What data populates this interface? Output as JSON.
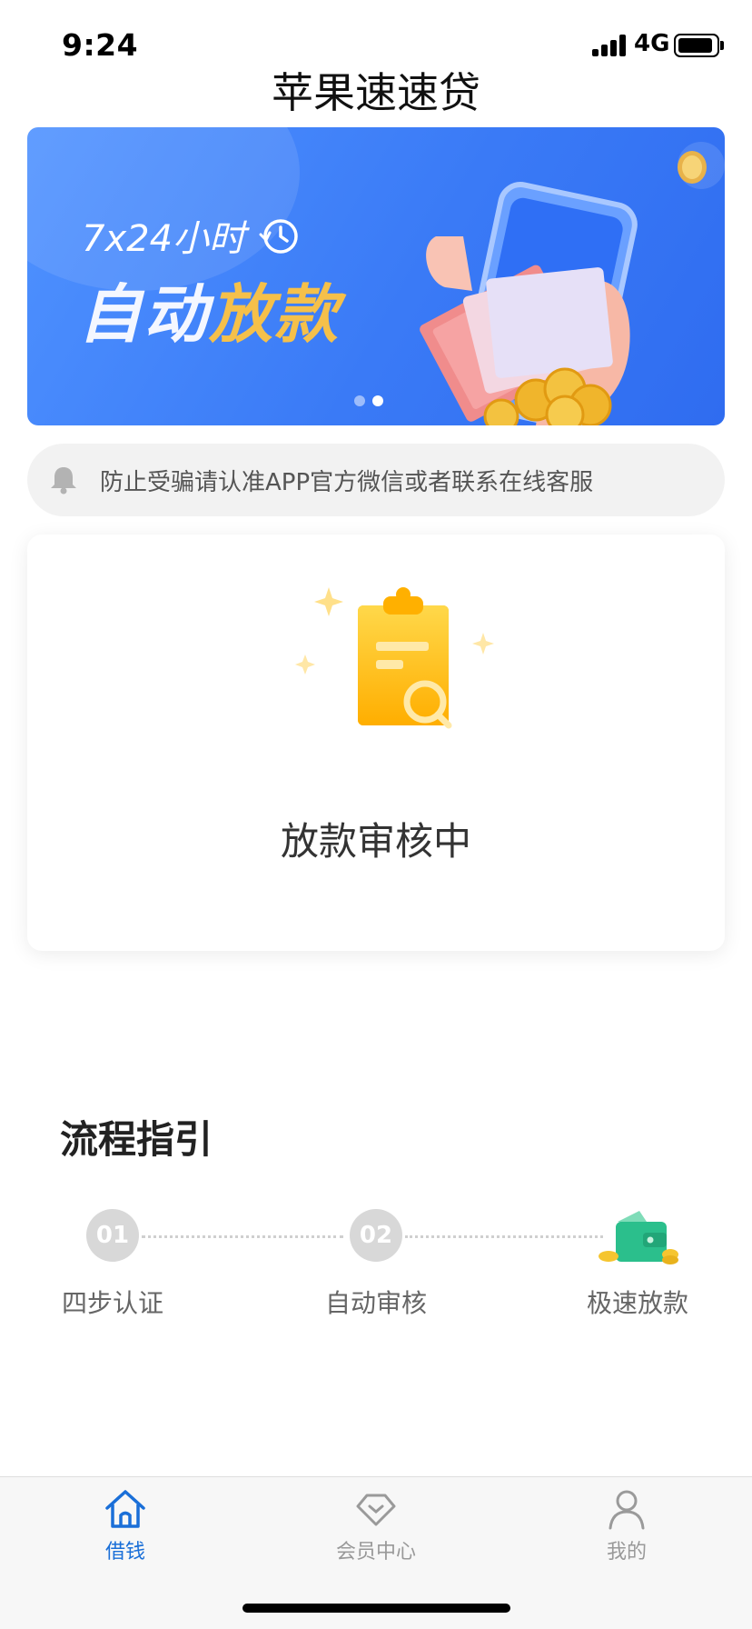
{
  "status_bar": {
    "time": "9:24",
    "network": "4G"
  },
  "app": {
    "title": "苹果速速贷"
  },
  "banner": {
    "line1": "7x24小时",
    "line2_white": "自动",
    "line2_gold": "放款",
    "active_dot": 1,
    "dot_count": 2
  },
  "notice": {
    "text": "防止受骗请认准APP官方微信或者联系在线客服",
    "icon": "bell-icon"
  },
  "review_card": {
    "status": "放款审核中",
    "icon": "clipboard-search-icon"
  },
  "guide": {
    "title": "流程指引",
    "steps": [
      {
        "number": "01",
        "label": "四步认证"
      },
      {
        "number": "02",
        "label": "自动审核"
      },
      {
        "number": "",
        "label": "极速放款",
        "icon": "wallet-icon"
      }
    ]
  },
  "tabbar": {
    "items": [
      {
        "label": "借钱",
        "icon": "home-icon",
        "active": true
      },
      {
        "label": "会员中心",
        "icon": "diamond-icon",
        "active": false
      },
      {
        "label": "我的",
        "icon": "person-icon",
        "active": false
      }
    ]
  },
  "colors": {
    "accent": "#1a6fd8",
    "banner": "#3a7af6",
    "gold": "#f5c04a",
    "wallet": "#2bbf8c"
  }
}
